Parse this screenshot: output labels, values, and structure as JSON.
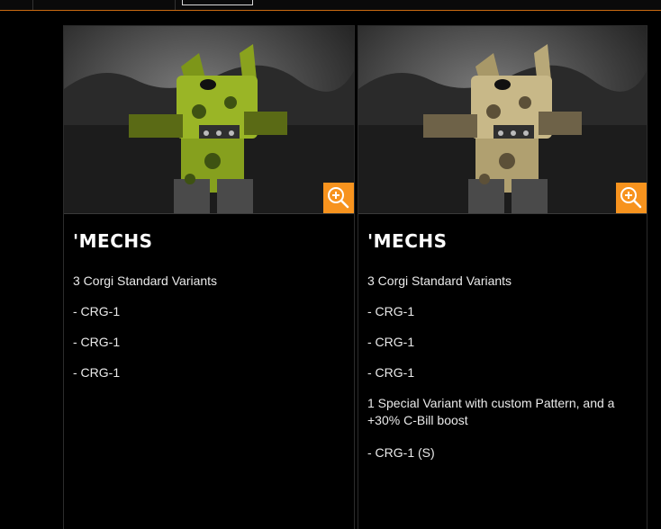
{
  "cards": [
    {
      "heading": "'MECHS",
      "intro": "3 Corgi Standard Variants",
      "variants": [
        "- CRG-1",
        "- CRG-1",
        "- CRG-1"
      ],
      "camo": "green",
      "zoom_icon": "zoom-in-icon"
    },
    {
      "heading": "'MECHS",
      "intro": "3 Corgi Standard Variants",
      "variants": [
        "- CRG-1",
        "- CRG-1",
        "- CRG-1"
      ],
      "special_text": "1 Special Variant with custom Pattern, and a +30% C-Bill boost",
      "special_variant": "- CRG-1 (S)",
      "camo": "tan",
      "zoom_icon": "zoom-in-icon"
    }
  ],
  "colors": {
    "accent": "#f7931e",
    "background": "#000000",
    "text": "#eaeaea"
  }
}
